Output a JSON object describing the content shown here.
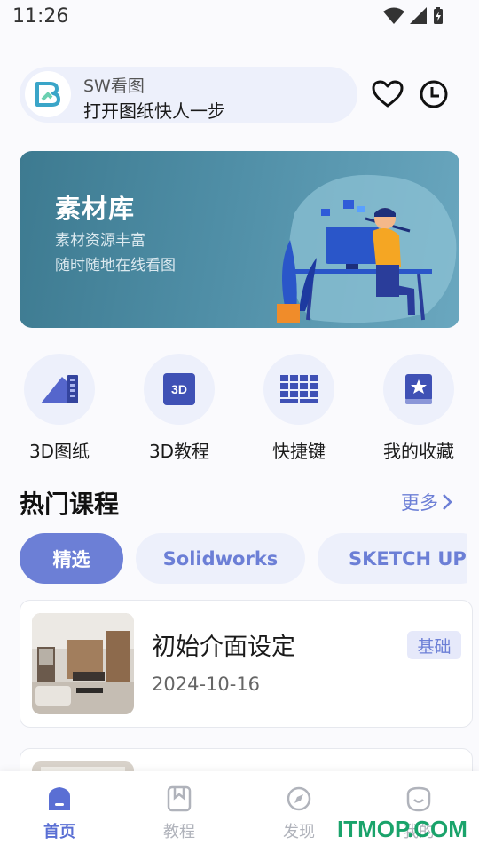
{
  "status_bar": {
    "time": "11:26"
  },
  "header": {
    "app_name": "SW看图",
    "slogan": "打开图纸快人一步",
    "favorite_icon": "heart-icon",
    "history_icon": "clock-icon"
  },
  "banner": {
    "title": "素材库",
    "line1": "素材资源丰富",
    "line2": "随时随地在线看图"
  },
  "quick_links": [
    {
      "label": "3D图纸",
      "icon": "blueprint-icon"
    },
    {
      "label": "3D教程",
      "icon": "3d-badge-icon",
      "badge": "3D"
    },
    {
      "label": "快捷键",
      "icon": "keyboard-icon"
    },
    {
      "label": "我的收藏",
      "icon": "bookmark-book-icon"
    }
  ],
  "section": {
    "title": "热门课程",
    "more": "更多"
  },
  "chips": [
    {
      "label": "精选",
      "active": true
    },
    {
      "label": "Solidworks",
      "active": false
    },
    {
      "label": "SKETCH UP",
      "active": false
    }
  ],
  "courses": [
    {
      "title": "初始介面设定",
      "date": "2024-10-16",
      "tag": "基础"
    }
  ],
  "bottom_nav": [
    {
      "label": "首页",
      "active": true,
      "icon": "home-icon"
    },
    {
      "label": "教程",
      "active": false,
      "icon": "book-icon"
    },
    {
      "label": "发现",
      "active": false,
      "icon": "compass-icon"
    },
    {
      "label": "我的",
      "active": false,
      "icon": "profile-icon"
    }
  ],
  "watermark": "ITMOP.COM",
  "colors": {
    "accent": "#6c7fd6",
    "chip_bg": "#edf0fb",
    "banner": "#4f8ea6"
  }
}
